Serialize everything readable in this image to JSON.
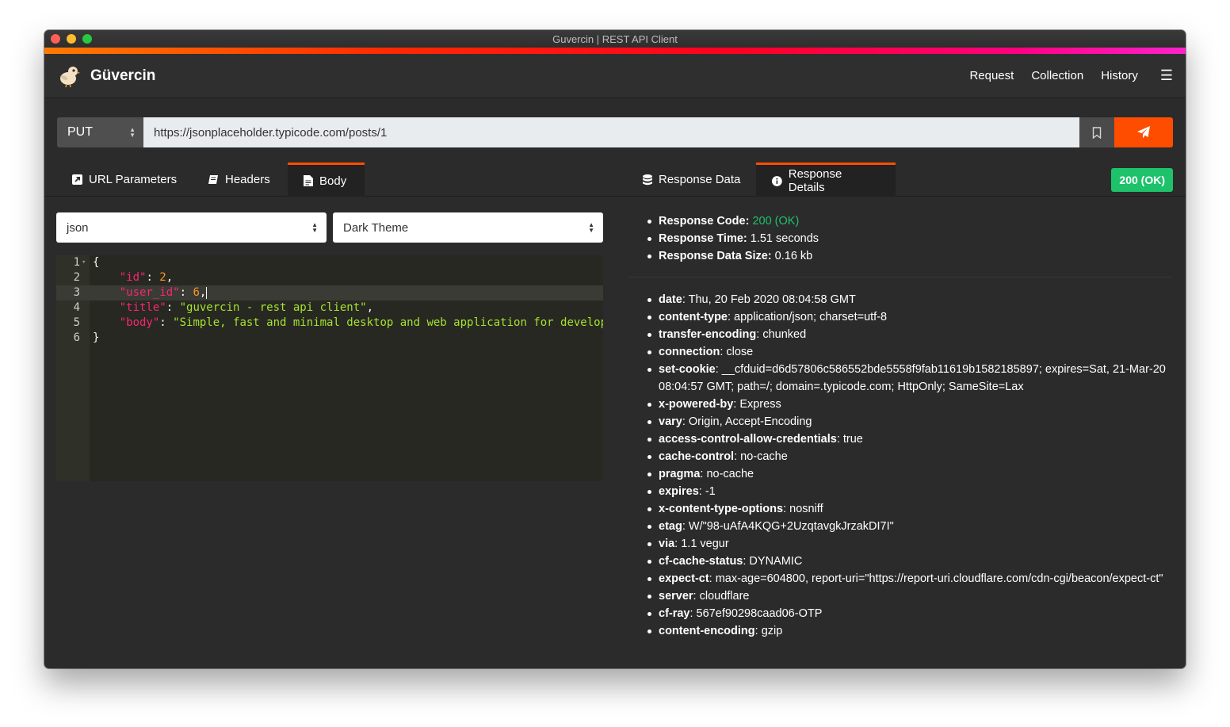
{
  "window": {
    "title": "Guvercin | REST API Client"
  },
  "navbar": {
    "brand": "Güvercin",
    "links": [
      "Request",
      "Collection",
      "History"
    ]
  },
  "request": {
    "method": "PUT",
    "url": "https://jsonplaceholder.typicode.com/posts/1"
  },
  "tabs": {
    "left": [
      {
        "label": "URL Parameters",
        "icon": "external-link-square-icon",
        "active": false
      },
      {
        "label": "Headers",
        "icon": "book-icon",
        "active": false
      },
      {
        "label": "Body",
        "icon": "file-text-icon",
        "active": true
      }
    ],
    "right": [
      {
        "label": "Response Data",
        "icon": "database-icon",
        "active": false
      },
      {
        "label": "Response Details",
        "icon": "info-circle-icon",
        "active": true
      }
    ]
  },
  "status_badge": "200 (OK)",
  "body_editor": {
    "format": "json",
    "theme": "Dark Theme",
    "line_numbers": [
      "1",
      "2",
      "3",
      "4",
      "5",
      "6"
    ],
    "lines": [
      {
        "parts": [
          {
            "t": "p",
            "v": "{"
          }
        ]
      },
      {
        "parts": [
          {
            "t": "p",
            "v": "    "
          },
          {
            "t": "k",
            "v": "\"id\""
          },
          {
            "t": "p",
            "v": ": "
          },
          {
            "t": "n",
            "v": "2"
          },
          {
            "t": "p",
            "v": ","
          }
        ]
      },
      {
        "parts": [
          {
            "t": "p",
            "v": "    "
          },
          {
            "t": "k",
            "v": "\"user_id\""
          },
          {
            "t": "p",
            "v": ": "
          },
          {
            "t": "n",
            "v": "6"
          },
          {
            "t": "p",
            "v": ","
          }
        ]
      },
      {
        "parts": [
          {
            "t": "p",
            "v": "    "
          },
          {
            "t": "k",
            "v": "\"title\""
          },
          {
            "t": "p",
            "v": ": "
          },
          {
            "t": "s",
            "v": "\"guvercin - rest api client\""
          },
          {
            "t": "p",
            "v": ","
          }
        ]
      },
      {
        "parts": [
          {
            "t": "p",
            "v": "    "
          },
          {
            "t": "k",
            "v": "\"body\""
          },
          {
            "t": "p",
            "v": ": "
          },
          {
            "t": "s",
            "v": "\"Simple, fast and minimal desktop and web application for develop"
          }
        ]
      },
      {
        "parts": [
          {
            "t": "p",
            "v": "}"
          }
        ]
      }
    ]
  },
  "response_summary": [
    {
      "key": "Response Code:",
      "value": "200 (OK)",
      "green": true
    },
    {
      "key": "Response Time:",
      "value": "1.51 seconds",
      "green": false
    },
    {
      "key": "Response Data Size:",
      "value": "0.16 kb",
      "green": false
    }
  ],
  "response_headers": [
    {
      "key": "date",
      "value": "Thu, 20 Feb 2020 08:04:58 GMT"
    },
    {
      "key": "content-type",
      "value": "application/json; charset=utf-8"
    },
    {
      "key": "transfer-encoding",
      "value": "chunked"
    },
    {
      "key": "connection",
      "value": "close"
    },
    {
      "key": "set-cookie",
      "value": "__cfduid=d6d57806c586552bde5558f9fab11619b1582185897; expires=Sat, 21-Mar-20 08:04:57 GMT; path=/; domain=.typicode.com; HttpOnly; SameSite=Lax"
    },
    {
      "key": "x-powered-by",
      "value": "Express"
    },
    {
      "key": "vary",
      "value": "Origin, Accept-Encoding"
    },
    {
      "key": "access-control-allow-credentials",
      "value": "true"
    },
    {
      "key": "cache-control",
      "value": "no-cache"
    },
    {
      "key": "pragma",
      "value": "no-cache"
    },
    {
      "key": "expires",
      "value": "-1"
    },
    {
      "key": "x-content-type-options",
      "value": "nosniff"
    },
    {
      "key": "etag",
      "value": "W/\"98-uAfA4KQG+2UzqtavgkJrzakDI7I\""
    },
    {
      "key": "via",
      "value": "1.1 vegur"
    },
    {
      "key": "cf-cache-status",
      "value": "DYNAMIC"
    },
    {
      "key": "expect-ct",
      "value": "max-age=604800, report-uri=\"https://report-uri.cloudflare.com/cdn-cgi/beacon/expect-ct\""
    },
    {
      "key": "server",
      "value": "cloudflare"
    },
    {
      "key": "cf-ray",
      "value": "567ef90298caad06-OTP"
    },
    {
      "key": "content-encoding",
      "value": "gzip"
    }
  ],
  "colors": {
    "accent": "#ff4d00",
    "success": "#1ec26b",
    "background": "#2b2b2b",
    "editor_background": "#272822"
  }
}
